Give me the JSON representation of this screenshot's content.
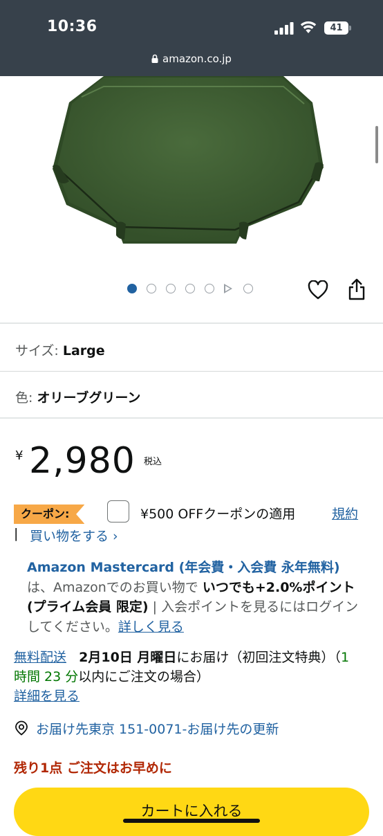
{
  "status_bar": {
    "time": "10:36",
    "battery": "41"
  },
  "browser": {
    "url": "amazon.co.jp"
  },
  "product": {
    "color_hex": "#3f5f34",
    "image_indicators": {
      "count": 7,
      "active_index": 0,
      "video_index": 5
    }
  },
  "variations": {
    "size_label": "サイズ: ",
    "size_value": "Large",
    "color_label": "色: ",
    "color_value": "オリーブグリーン"
  },
  "price": {
    "symbol": "¥",
    "amount": "2,980",
    "tax_note": "税込"
  },
  "coupon": {
    "badge": "クーポン:",
    "text": "¥500 OFFクーポンの適用",
    "terms_link": "規約",
    "separator": "|",
    "shop_link": "買い物をする ›"
  },
  "promo": {
    "line_card": "Amazon Mastercard (年会費・入会費 永年無料)",
    "text_1": "は、Amazonでのお買い物で ",
    "bold_points": "いつでも+2.0%ポイント (プライム会員 限定)",
    "text_2": " | 入会ポイントを見るにはログインしてください。",
    "details_link": "詳しく見る"
  },
  "delivery": {
    "free_shipping": "無料配送",
    "date": "2月10日 月曜日",
    "text_1": "にお届け（初回注文特典）（",
    "countdown": "1 時間 23 分",
    "text_2": "以内にご注文の場合）",
    "details_link": "詳細を見る"
  },
  "location": {
    "text": "お届け先東京 151-0071-お届け先の更新"
  },
  "stock": {
    "text": "残り1点 ご注文はお早めに"
  },
  "cart_button": {
    "label": "カートに入れる"
  },
  "colors": {
    "header_bg": "#37414b",
    "link": "#2162a1",
    "cart": "#ffd814",
    "coupon": "#f7a847",
    "stock": "#b12704",
    "green": "#007600"
  }
}
